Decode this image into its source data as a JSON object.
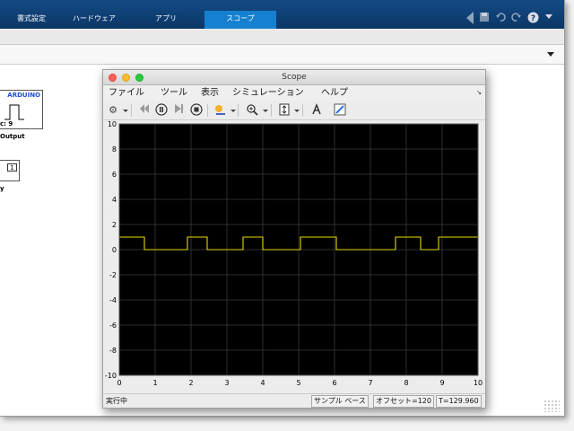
{
  "ribbon": {
    "tabs": [
      {
        "label": "書式設定",
        "active": false
      },
      {
        "label": "ハードウェア",
        "active": false
      },
      {
        "label": "アプリ",
        "active": false
      },
      {
        "label": "スコープ",
        "active": true
      }
    ],
    "quick_access": [
      "save-icon",
      "undo-icon",
      "redo-icon",
      "help-icon",
      "dropdown-icon"
    ],
    "help_glyph": "?"
  },
  "model": {
    "arduino_block": {
      "logo": "ARDUINO",
      "pin": "c: 9",
      "name": "Output"
    },
    "constant_block": {
      "value": "1",
      "name": "y"
    }
  },
  "scope": {
    "title": "Scope",
    "menu": [
      "ファイル",
      "ツール",
      "表示",
      "シミュレーション",
      "ヘルプ"
    ],
    "toolbar": [
      "settings-icon",
      "step-back-icon",
      "run-icon",
      "step-forward-icon",
      "stop-icon",
      "highlight-icon",
      "zoom-icon",
      "autoscale-icon",
      "signal-select-icon",
      "style-icon"
    ],
    "status": {
      "state": "実行中",
      "mode": "サンプル ベース",
      "offset": "オフセット=120",
      "time": "T=129.960"
    },
    "colors": {
      "background": "#000000",
      "grid": "#3a3a3a",
      "signal": "#e6d800",
      "axes_text": "#000000"
    }
  },
  "chart_data": {
    "type": "line",
    "title": "",
    "xlabel": "",
    "ylabel": "",
    "xlim": [
      0,
      10
    ],
    "ylim": [
      -10,
      10
    ],
    "x_ticks": [
      "0",
      "1",
      "2",
      "3",
      "4",
      "5",
      "6",
      "7",
      "8",
      "9",
      "10"
    ],
    "y_ticks": [
      "10",
      "8",
      "6",
      "4",
      "2",
      "0",
      "-2",
      "-4",
      "-6",
      "-8",
      "-10"
    ],
    "grid": true,
    "series": [
      {
        "x": [
          0,
          0.7,
          0.7,
          1.9,
          1.9,
          2.45,
          2.45,
          3.45,
          3.45,
          4.0,
          4.0,
          5.05,
          5.05,
          6.05,
          6.05,
          7.7,
          7.7,
          8.4,
          8.4,
          8.9,
          8.9,
          10
        ],
        "y": [
          1,
          1,
          0,
          0,
          1,
          1,
          0,
          0,
          1,
          1,
          0,
          0,
          1,
          1,
          0,
          0,
          1,
          1,
          0,
          0,
          1,
          1
        ]
      }
    ]
  }
}
